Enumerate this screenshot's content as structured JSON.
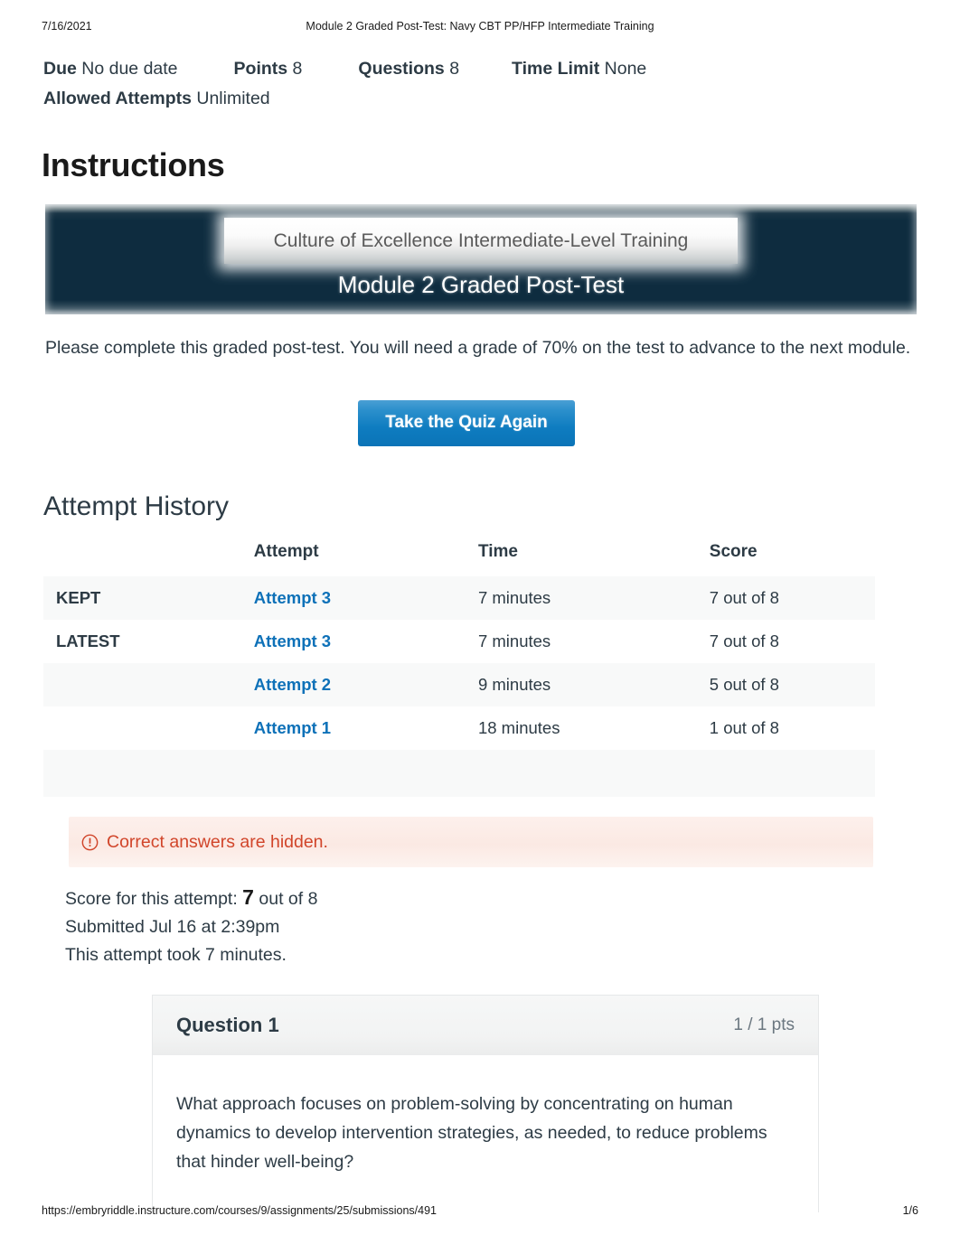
{
  "print_header": {
    "date": "7/16/2021",
    "title": "Module 2 Graded Post-Test: Navy CBT PP/HFP Intermediate Training"
  },
  "meta": {
    "due_label": "Due",
    "due_value": "No due date",
    "points_label": "Points",
    "points_value": "8",
    "questions_label": "Questions",
    "questions_value": "8",
    "time_limit_label": "Time Limit",
    "time_limit_value": "None",
    "allowed_attempts_label": "Allowed Attempts",
    "allowed_attempts_value": "Unlimited"
  },
  "instructions": {
    "heading": "Instructions",
    "banner_subtitle": "Culture of Excellence Intermediate-Level Training",
    "banner_title": "Module 2 Graded Post-Test",
    "body": "Please complete this graded post-test. You will need a grade of 70% on the test to advance to the next module."
  },
  "actions": {
    "take_quiz_again": "Take the Quiz Again"
  },
  "attempt_history": {
    "heading": "Attempt History",
    "columns": [
      "",
      "Attempt",
      "Time",
      "Score"
    ],
    "rows": [
      {
        "tag": "KEPT",
        "attempt": "Attempt 3",
        "time": "7 minutes",
        "score": "7 out of 8"
      },
      {
        "tag": "LATEST",
        "attempt": "Attempt 3",
        "time": "7 minutes",
        "score": "7 out of 8"
      },
      {
        "tag": "",
        "attempt": "Attempt 2",
        "time": "9 minutes",
        "score": "5 out of 8"
      },
      {
        "tag": "",
        "attempt": "Attempt 1",
        "time": "18 minutes",
        "score": "1 out of 8"
      }
    ]
  },
  "alert": {
    "icon": "exclamation-circle-icon",
    "text": "Correct answers are hidden.",
    "color": "#d1452a"
  },
  "submission": {
    "score_prefix": "Score for this attempt:",
    "score_value": "7",
    "score_suffix": "out of 8",
    "submitted": "Submitted Jul 16 at 2:39pm",
    "duration": "This attempt took 7 minutes."
  },
  "question": {
    "title": "Question 1",
    "points": "1 / 1 pts",
    "text": "What approach focuses on problem-solving by concentrating on human dynamics to develop intervention strategies, as needed, to reduce problems that hinder well-being?"
  },
  "print_footer": {
    "url": "https://embryriddle.instructure.com/courses/9/assignments/25/submissions/491",
    "page": "1/6"
  },
  "colors": {
    "link": "#0e71b8",
    "banner_navy": "#0e2c3f",
    "button_blue": "#0e7cc0",
    "alert_orange": "#d1452a"
  }
}
